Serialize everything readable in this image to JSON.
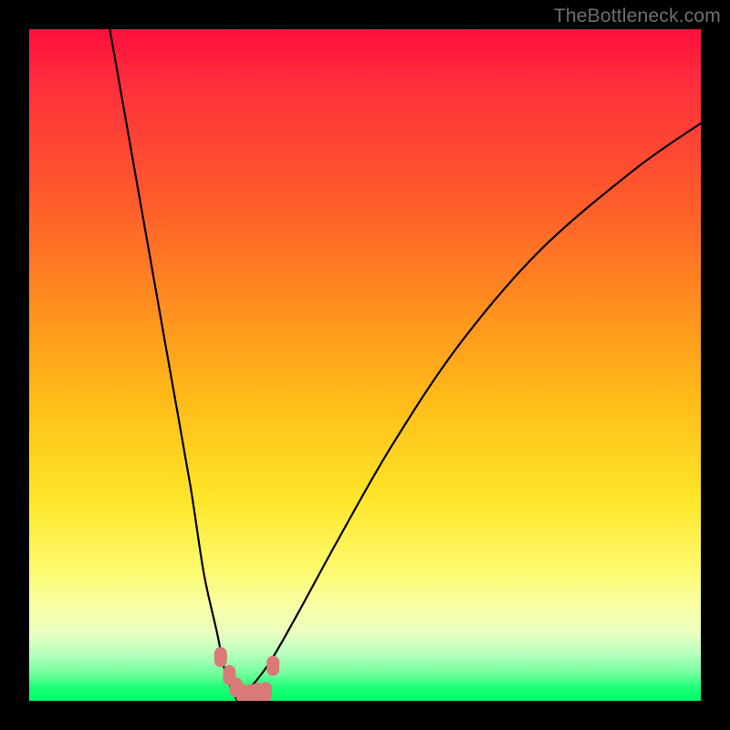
{
  "watermark": "TheBottleneck.com",
  "colors": {
    "background": "#000000",
    "curve": "#000000",
    "marker": "#d97a78",
    "gradient_stops": [
      "#ff0f3c",
      "#ff5a2c",
      "#ffbb18",
      "#fdf96a",
      "#70ff9a",
      "#00ff66"
    ]
  },
  "chart_data": {
    "type": "line",
    "title": "",
    "xlabel": "",
    "ylabel": "",
    "xlim": [
      0,
      100
    ],
    "ylim": [
      0,
      100
    ],
    "grid": false,
    "legend": false,
    "note": "Two V-shaped bottleneck curves meeting near x≈31; y-axis is bottleneck percent (high=red, low=green). Values estimated from pixel positions.",
    "series": [
      {
        "name": "left-branch",
        "x": [
          12,
          15,
          18,
          21,
          24,
          26,
          28,
          29,
          30,
          31
        ],
        "y": [
          100,
          83,
          66,
          49,
          32,
          19,
          10,
          5,
          2,
          0
        ]
      },
      {
        "name": "right-branch",
        "x": [
          31,
          33,
          36,
          40,
          46,
          54,
          64,
          76,
          90,
          100
        ],
        "y": [
          0,
          2,
          6,
          13,
          24,
          38,
          53,
          67,
          79,
          86
        ]
      }
    ],
    "markers": {
      "name": "highlighted-points",
      "x": [
        28.5,
        29.8,
        30.8,
        31.8,
        33.0,
        34.0,
        35.2,
        36.3
      ],
      "y": [
        6.5,
        3.8,
        2.0,
        1.0,
        1.0,
        1.2,
        1.3,
        5.2
      ]
    }
  }
}
